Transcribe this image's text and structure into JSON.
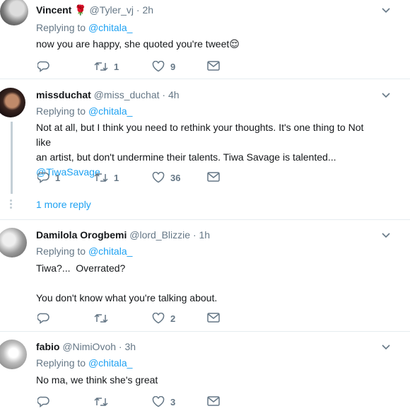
{
  "tweets": [
    {
      "name": "Vincent",
      "name_emoji": "🌹",
      "handle": "@Tyler_vj",
      "time": "2h",
      "replying_label": "Replying to",
      "replying_to": "@chitala_",
      "text": "now you are happy, she quoted you're tweet",
      "text_emoji": "😌",
      "replies": "",
      "retweets": "1",
      "likes": "9"
    },
    {
      "name": "missduchat",
      "handle": "@miss_duchat",
      "time": "4h",
      "replying_label": "Replying to",
      "replying_to": "@chitala_",
      "text_line1": "Not at all, but I think you need to rethink your thoughts. It's one thing to Not like",
      "text_line2": "an artist, but don't undermine their talents. Tiwa Savage is talented...",
      "text_mention": "@TiwaSavage",
      "replies": "1",
      "retweets": "1",
      "likes": "36",
      "more_reply": "1 more reply"
    },
    {
      "name": "Damilola Orogbemi",
      "handle": "@lord_Blizzie",
      "time": "1h",
      "replying_label": "Replying to",
      "replying_to": "@chitala_",
      "text_line1": "Tiwa?...  Overrated?",
      "text_line2": "You don't know what you're talking about.",
      "replies": "",
      "retweets": "",
      "likes": "2"
    },
    {
      "name": "fabio",
      "handle": "@NimiOvoh",
      "time": "3h",
      "replying_label": "Replying to",
      "replying_to": "@chitala_",
      "text": "No ma, we think she's great",
      "replies": "",
      "retweets": "",
      "likes": "3"
    }
  ],
  "separator": "·",
  "colors": {
    "link": "#1da1f2",
    "muted": "#657786",
    "border": "#e6ecf0",
    "thread": "#c4cfd6"
  },
  "icons": [
    "reply-icon",
    "retweet-icon",
    "like-icon",
    "message-icon",
    "chevron-down-icon"
  ]
}
